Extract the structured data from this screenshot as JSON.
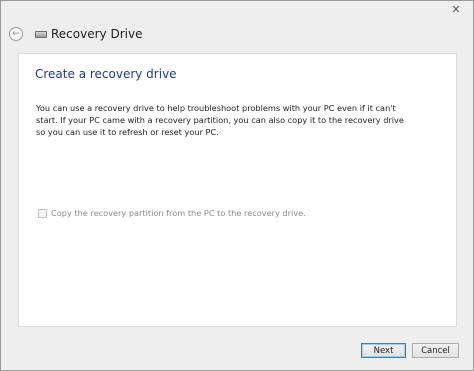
{
  "window": {
    "close_glyph": "✕"
  },
  "titlebar": {
    "title": "Recovery Drive",
    "back_glyph": "←"
  },
  "main": {
    "heading": "Create a recovery drive",
    "description": "You can use a recovery drive to help troubleshoot problems with your PC even if it can't start. If your PC came with a recovery partition, you can also copy it to the recovery drive so you can use it to refresh or reset your PC.",
    "checkbox": {
      "label": "Copy the recovery partition from the PC to the recovery drive.",
      "checked": false,
      "enabled": false
    }
  },
  "footer": {
    "next_label": "Next",
    "cancel_label": "Cancel"
  }
}
